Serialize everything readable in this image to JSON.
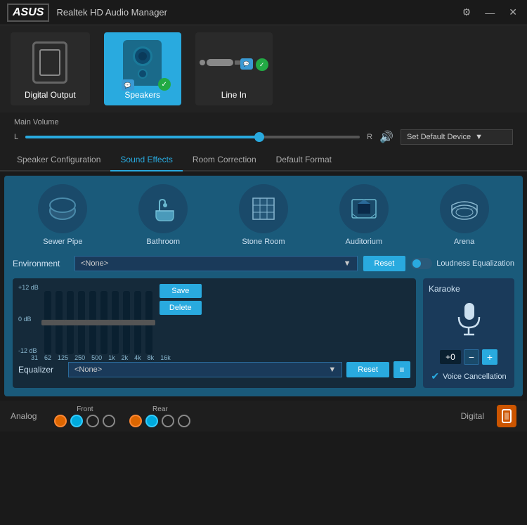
{
  "app": {
    "logo": "/asus",
    "logo_display": "ASUS",
    "title": "Realtek HD Audio Manager"
  },
  "title_bar": {
    "settings_label": "⚙",
    "minimize_label": "—",
    "close_label": "✕"
  },
  "devices": [
    {
      "id": "digital-output",
      "label": "Digital Output",
      "active": false
    },
    {
      "id": "speakers",
      "label": "Speakers",
      "active": true
    },
    {
      "id": "line-in",
      "label": "Line In",
      "active": false
    }
  ],
  "volume": {
    "label": "Main Volume",
    "l_label": "L",
    "r_label": "R",
    "level_pct": 70,
    "default_device_label": "Set Default Device"
  },
  "tabs": [
    {
      "id": "speaker-config",
      "label": "Speaker Configuration",
      "active": false
    },
    {
      "id": "sound-effects",
      "label": "Sound Effects",
      "active": true
    },
    {
      "id": "room-correction",
      "label": "Room Correction",
      "active": false
    },
    {
      "id": "default-format",
      "label": "Default Format",
      "active": false
    }
  ],
  "environments": [
    {
      "id": "sewer-pipe",
      "label": "Sewer Pipe",
      "icon": "🔘"
    },
    {
      "id": "bathroom",
      "label": "Bathroom",
      "icon": "🛁"
    },
    {
      "id": "stone-room",
      "label": "Stone Room",
      "icon": "⬜"
    },
    {
      "id": "auditorium",
      "label": "Auditorium",
      "icon": "🎭"
    },
    {
      "id": "arena",
      "label": "Arena",
      "icon": "🏟"
    }
  ],
  "environment_control": {
    "label": "Environment",
    "dropdown_value": "<None>",
    "reset_label": "Reset",
    "loudness_label": "Loudness Equalization"
  },
  "equalizer": {
    "db_labels": [
      "+12 dB",
      "0 dB",
      "-12 dB"
    ],
    "freq_labels": [
      "31",
      "62",
      "125",
      "250",
      "500",
      "1k",
      "2k",
      "4k",
      "8k",
      "16k"
    ],
    "save_label": "Save",
    "delete_label": "Delete",
    "label": "Equalizer",
    "dropdown_value": "<None>",
    "reset_label": "Reset"
  },
  "karaoke": {
    "title": "Karaoke",
    "value": "+0",
    "minus_label": "−",
    "plus_label": "+",
    "voice_cancel_label": "Voice Cancellation"
  },
  "bottom_bar": {
    "analog_label": "Analog",
    "front_label": "Front",
    "rear_label": "Rear",
    "digital_label": "Digital",
    "front_dots": [
      "#dd6600",
      "#00aadd",
      "#888888",
      "#aa00aa"
    ],
    "rear_dots": [
      "#dd6600",
      "#00aadd",
      "#888888",
      "#aa00aa"
    ]
  }
}
